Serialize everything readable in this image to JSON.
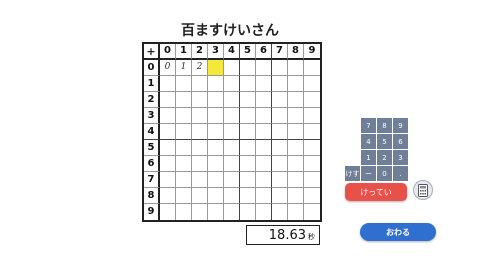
{
  "title": "百ますけいさん",
  "corner_op": "+",
  "col_headers": [
    "0",
    "1",
    "2",
    "3",
    "4",
    "5",
    "6",
    "7",
    "8",
    "9"
  ],
  "row_headers": [
    "0",
    "1",
    "2",
    "3",
    "4",
    "5",
    "6",
    "7",
    "8",
    "9"
  ],
  "entries": [
    {
      "row": 0,
      "col": 0,
      "value": "0"
    },
    {
      "row": 0,
      "col": 1,
      "value": "1"
    },
    {
      "row": 0,
      "col": 2,
      "value": "2"
    }
  ],
  "active_cell": {
    "row": 0,
    "col": 3
  },
  "colors": {
    "active": "#f4e83a",
    "keypad": "#6f7f98",
    "answer": "#e8504a",
    "end": "#2f6fd0"
  },
  "timer": {
    "value": "18.63",
    "unit": "秒"
  },
  "keypad": [
    [
      "",
      "7",
      "8",
      "9"
    ],
    [
      "",
      "4",
      "5",
      "6"
    ],
    [
      "",
      "1",
      "2",
      "3"
    ],
    [
      "けす",
      "ー",
      "0",
      "."
    ]
  ],
  "answer_button": "けってい",
  "end_button": "おわる",
  "calculator_icon": "calculator-icon"
}
